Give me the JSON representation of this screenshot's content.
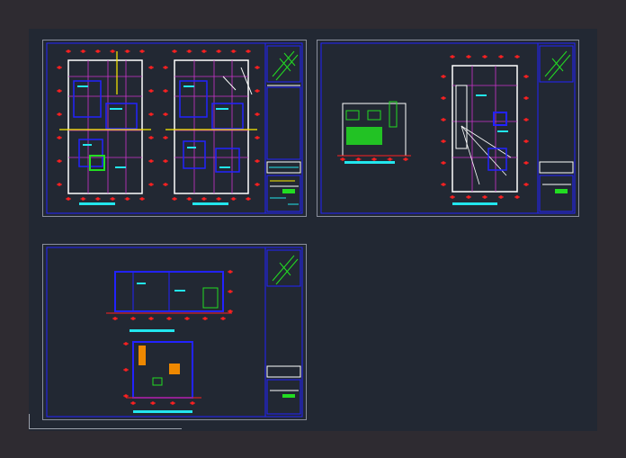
{
  "colors": {
    "background": "#2e2b31",
    "model_space": "#222833",
    "sheet_border": "#8a8f9c",
    "frame_blue": "#2222ff",
    "wall_red": "#ff2020",
    "grid_magenta": "#cc33cc",
    "text_cyan": "#22e6ee",
    "hatch_green": "#22dd22",
    "white": "#ffffff",
    "yellow": "#ffee00",
    "orange": "#ee8800"
  },
  "sheets": [
    {
      "id": "sheet-1",
      "content": "two-floor-plans"
    },
    {
      "id": "sheet-2",
      "content": "elevation-and-roof-plan"
    },
    {
      "id": "sheet-3",
      "content": "sections"
    }
  ],
  "icons": [
    "north-arrow-icon",
    "ucs-axis-icon"
  ]
}
